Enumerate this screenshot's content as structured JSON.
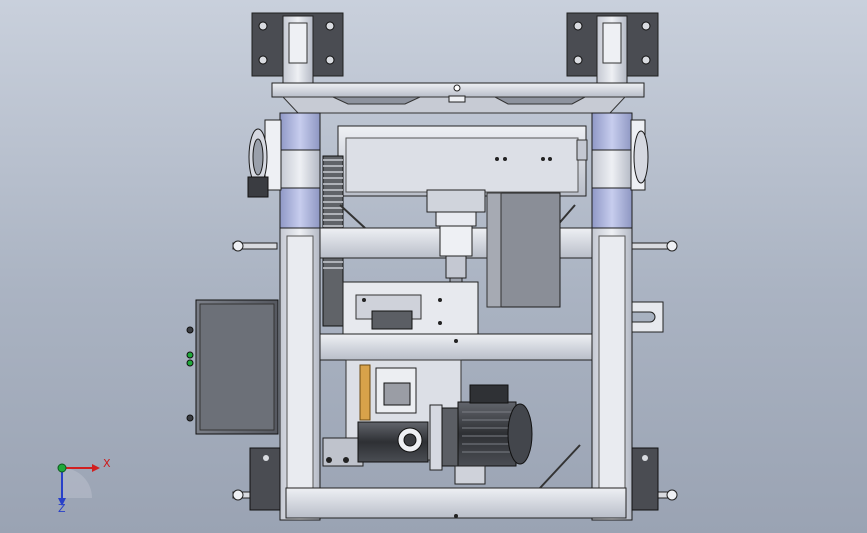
{
  "viewport": {
    "background_top": "#c9d0dc",
    "background_bottom": "#9aa3b3",
    "part_color": "#d8dbe3",
    "part_shade": "#9aa0ad",
    "edge_color": "#2a2a2a",
    "motor_color": "#3d3f44",
    "bearing_color": "#aab2d6"
  },
  "triad": {
    "x_label": "X",
    "z_label": "Z",
    "x_color": "#d21f1f",
    "y_color": "#1fa83a",
    "z_color": "#2840c9"
  }
}
